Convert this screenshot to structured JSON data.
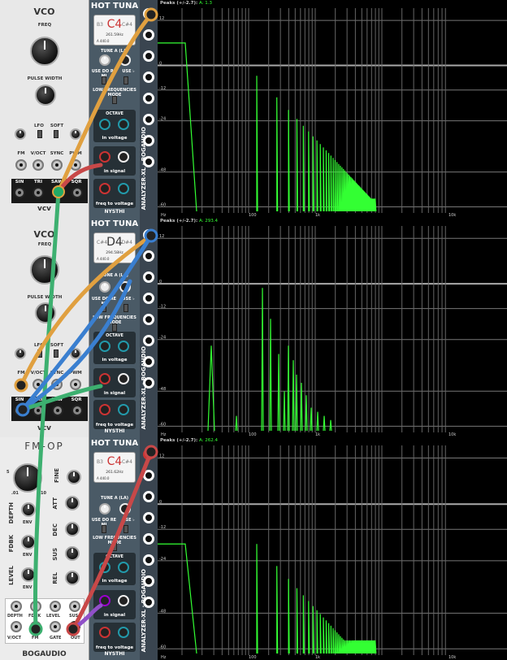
{
  "vco": {
    "title": "VCO",
    "freq": "FREQ",
    "pw": "PULSE WIDTH",
    "lfo": "LFO",
    "soft": "SOFT",
    "jack_labels": [
      "FM",
      "V/OCT",
      "SYNC",
      "PWM"
    ],
    "out_labels": [
      "SIN",
      "TRI",
      "SAW",
      "SQR"
    ],
    "brand": "vcv"
  },
  "fmop": {
    "title": "FM-OP",
    "fine": "FINE",
    "depth": "DEPTH",
    "att": "ATT",
    "fdbk": "FDBK",
    "dec": "DEC",
    "level": "LEVEL",
    "sus": "SUS",
    "rel": "REL",
    "env": "ENV",
    "jack_top": [
      "DEPTH",
      "FDBK",
      "LEVEL",
      "SUS"
    ],
    "jack_bot": [
      "V/OCT",
      "FM",
      "GATE",
      "OUT"
    ],
    "brand": "BOGAUDIO",
    "scale_5": "5",
    "scale_01": ".01",
    "scale_10": "10",
    "scale_0": "0"
  },
  "tuna": {
    "title": "HOT TUNA",
    "tune": "TUNE A (LA)",
    "usedo": "USE DO RE MI",
    "use_b": "USE ♭",
    "lowfreq": "LOW FREQUENCIES MODE",
    "octave": "OCTAVE",
    "in_voltage": "in voltage",
    "in_signal": "in signal",
    "freq_to_voltage": "freq to voltage",
    "brand": "NYSTHI",
    "a_ref": "A 440.0",
    "units": [
      {
        "note": "C4",
        "freq": "261.59Hz",
        "left": "B3",
        "right": "C#4"
      },
      {
        "note": "D4",
        "freq": "294.58Hz",
        "left": "C#4",
        "right": "D#4"
      },
      {
        "note": "C4",
        "freq": "261.62Hz",
        "left": "B3",
        "right": "C#4"
      }
    ]
  },
  "analyzer": {
    "label": "ANALYZER-XL · BOGAUDIO",
    "peaks_prefix": "Peaks (+/-2.7):",
    "peaks_a_label": "A:",
    "peaks": [
      "1.3",
      "293.4",
      "262.4"
    ],
    "ticks_x": [
      "Hz",
      "100",
      "1k",
      "10k"
    ],
    "ticks_y": [
      "12",
      "0",
      "-12",
      "-24",
      "-48",
      "-60"
    ]
  },
  "colors": {
    "trace": "#33ff33",
    "cable_orange": "#e0a040",
    "cable_blue": "#3a7fd0",
    "cable_green": "#3db070",
    "cable_red": "#c84848",
    "cable_purple": "#9050c8"
  }
}
